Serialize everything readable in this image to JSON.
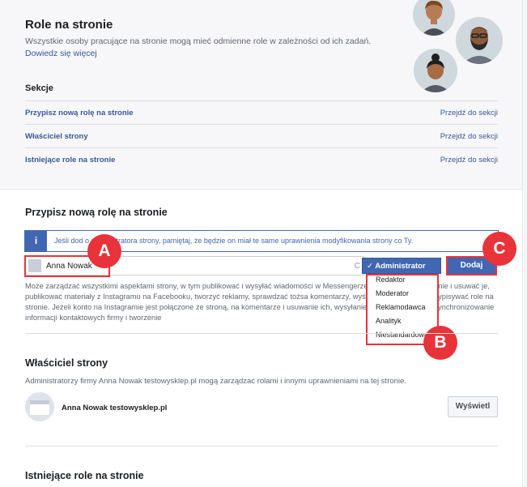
{
  "header": {
    "title": "Role na stronie",
    "subtitle": "Wszystkie osoby pracujące na stronie mogą mieć odmienne role w zależności od ich zadań.",
    "learn_more": "Dowiedz się więcej"
  },
  "sections": {
    "label": "Sekcje",
    "items": [
      {
        "label": "Przypisz nową rolę na stronie",
        "link": "Przejdź do sekcji"
      },
      {
        "label": "Właściciel strony",
        "link": "Przejdź do sekcji"
      },
      {
        "label": "Istniejące role na stronie",
        "link": "Przejdź do sekcji"
      }
    ]
  },
  "assign": {
    "title": "Przypisz nową rolę na stronie",
    "info_icon": "i",
    "info_text": "Jeśli dod          o administratora strony, pamiętaj, że będzie on miał te same uprawnienia modyfikowania strony co Ty.",
    "name_value": "Anna Nowak",
    "clear_symbol": "C",
    "description": "Może zarządzać wszystkimi aspektami strony, w tym publikować i wysyłać wiadomości w Messengerze j                                komentarze na stronie i usuwać je, publikować materiały z Instagramu na Facebooku, tworzyć reklamy, sprawdzać tożsa                                 komentarzy, wyświetlać statystyki i przypisywać role na stronie. Jeżeli konto na Instagramie jest połączone ze stroną,                                na komentarze i usuwanie ich, wysyłanie wiadomości Direct, synchronizowanie informacji kontaktowych firmy i tworzenie",
    "selected_role": "✓ Administrator",
    "role_options": [
      "Redaktor",
      "Moderator",
      "Reklamodawca",
      "Analityk",
      "Niestandardowa"
    ],
    "add_button": "Dodaj"
  },
  "markers": {
    "a": "A",
    "b": "B",
    "c": "C"
  },
  "owner": {
    "title": "Właściciel strony",
    "description": "Administratorzy firmy Anna Nowak testowysklep.pl mogą zarządzać rolami i innymi uprawnieniami na tej stronie.",
    "name": "Anna Nowak testowysklep.pl",
    "view_button": "Wyświetl"
  },
  "existing": {
    "title": "Istniejące role na stronie"
  },
  "colors": {
    "accent": "#4267b2",
    "highlight": "#e8333a",
    "link": "#385898"
  },
  "icons": {
    "info": "info-icon",
    "avatars": [
      "woman-avatar-icon",
      "man-beard-avatar-icon",
      "woman-bun-avatar-icon"
    ],
    "checkmark": "checkmark-icon"
  }
}
